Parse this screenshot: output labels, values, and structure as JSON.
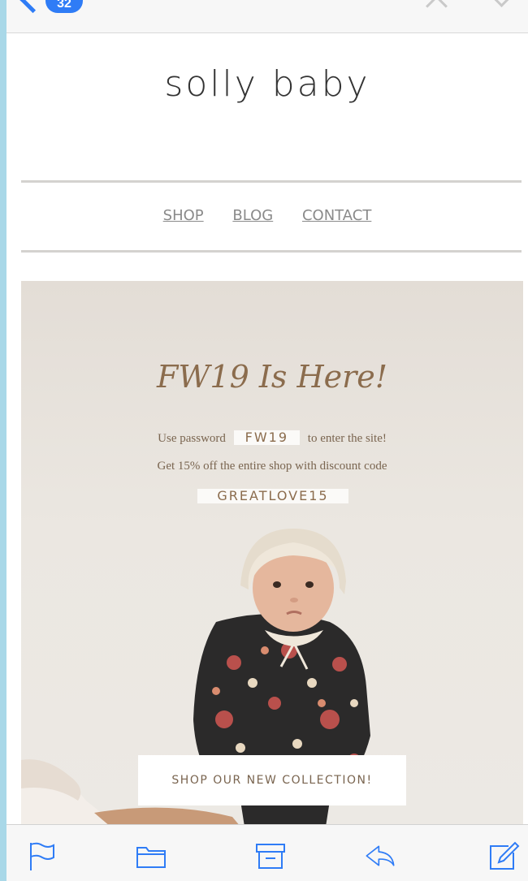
{
  "mail_header": {
    "unread_count": "32"
  },
  "email": {
    "logo": "solly baby",
    "nav": [
      {
        "label": "SHOP"
      },
      {
        "label": "BLOG"
      },
      {
        "label": "CONTACT"
      }
    ],
    "hero": {
      "title": "FW19 Is Here!",
      "password_prefix": "Use password",
      "password": "FW19",
      "password_suffix": "to enter the site!",
      "discount_text": "Get 15% off the entire shop with discount code",
      "discount_code": "GREATLOVE15",
      "cta_label": "SHOP OUR NEW COLLECTION!"
    }
  },
  "toolbar": {
    "icons": [
      "flag-icon",
      "folder-icon",
      "archive-icon",
      "reply-icon",
      "compose-icon"
    ]
  },
  "colors": {
    "accent": "#2f7cf6",
    "hero_text": "#8b6c4d",
    "frame": "#a9d8e8"
  }
}
